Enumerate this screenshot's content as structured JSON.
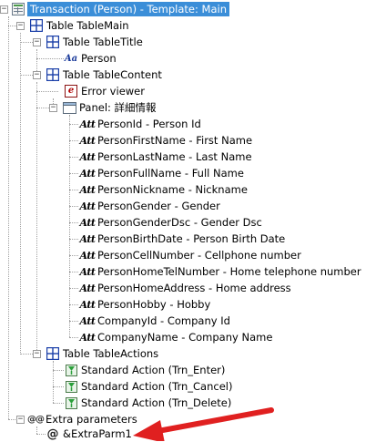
{
  "tree": {
    "root": "Transaction (Person) - Template: Main",
    "table_main": "Table TableMain",
    "table_title": "Table TableTitle",
    "person_text": "Person",
    "table_content": "Table TableContent",
    "error_viewer": "Error viewer",
    "panel": "Panel: 詳細情報",
    "attributes": [
      "PersonId - Person Id",
      "PersonFirstName - First Name",
      "PersonLastName - Last Name",
      "PersonFullName - Full Name",
      "PersonNickname - Nickname",
      "PersonGender - Gender",
      "PersonGenderDsc - Gender Dsc",
      "PersonBirthDate - Person Birth Date",
      "PersonCellNumber - Cellphone number",
      "PersonHomeTelNumber - Home telephone number",
      "PersonHomeAddress - Home address",
      "PersonHobby - Hobby",
      "CompanyId - Company Id",
      "CompanyName - Company Name"
    ],
    "attribute_glyph": "Att",
    "text_glyph": "Aa",
    "error_glyph": "e",
    "table_actions": "Table TableActions",
    "actions": [
      "Standard Action (Trn_Enter)",
      "Standard Action (Trn_Cancel)",
      "Standard Action (Trn_Delete)"
    ],
    "extra_parameters": "Extra parameters",
    "extra_glyph": "@@",
    "extra_parm": "&ExtraParm1",
    "param_glyph": "@"
  },
  "colors": {
    "selection": "#3b8ed8",
    "table_icon": "#1a3fa8",
    "arrow": "#e02020",
    "action_icon": "#2aa03a"
  }
}
